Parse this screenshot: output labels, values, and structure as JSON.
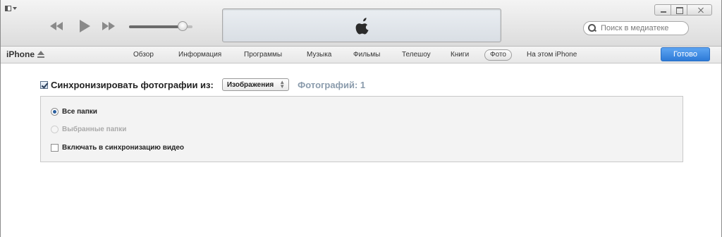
{
  "titlebar": {
    "menu_icon": "sidebar-menu-icon",
    "search": {
      "placeholder": "Поиск в медиатеке"
    },
    "volume_level": 0.84,
    "now_playing_logo": "apple-logo-icon"
  },
  "device": {
    "name": "iPhone",
    "eject_icon": "eject-icon"
  },
  "tabs": [
    {
      "label": "Обзор",
      "active": false
    },
    {
      "label": "Информация",
      "active": false
    },
    {
      "label": "Программы",
      "active": false
    },
    {
      "label": "Музыка",
      "active": false
    },
    {
      "label": "Фильмы",
      "active": false
    },
    {
      "label": "Телешоу",
      "active": false
    },
    {
      "label": "Книги",
      "active": false
    },
    {
      "label": "Фото",
      "active": true
    },
    {
      "label": "На этом iPhone",
      "active": false
    }
  ],
  "done_button": "Готово",
  "sync": {
    "checked": true,
    "label": "Синхронизировать фотографии из:",
    "source": "Изображения",
    "count_text": "Фотографий: 1"
  },
  "options": {
    "all_folders": "Все папки",
    "selected_folders": "Выбранные папки",
    "include_video": "Включать в синхронизацию видео"
  },
  "colors": {
    "accent_button": "#2d7ad7",
    "count_text": "#8a9bac"
  }
}
